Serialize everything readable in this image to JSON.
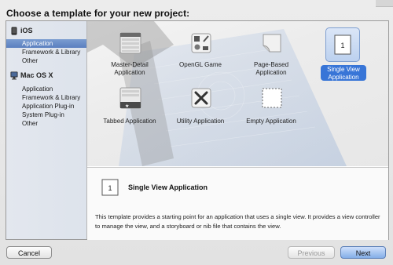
{
  "heading": "Choose a template for your new project:",
  "sidebar": {
    "sections": [
      {
        "title": "iOS",
        "items": [
          "Application",
          "Framework & Library",
          "Other"
        ]
      },
      {
        "title": "Mac OS X",
        "items": [
          "Application",
          "Application Plug-in",
          "Framework & Library",
          "System Plug-in",
          "Other"
        ]
      }
    ],
    "selected": "iOS / Application"
  },
  "templates": [
    {
      "label": "Master-Detail Application",
      "icon": "master-detail-icon"
    },
    {
      "label": "OpenGL Game",
      "icon": "opengl-game-icon"
    },
    {
      "label": "Page-Based Application",
      "icon": "page-based-icon"
    },
    {
      "label": "Single View Application",
      "icon": "single-view-icon",
      "selected": true
    },
    {
      "label": "Tabbed Application",
      "icon": "tabbed-icon"
    },
    {
      "label": "Utility Application",
      "icon": "utility-icon"
    },
    {
      "label": "Empty Application",
      "icon": "empty-app-icon"
    }
  ],
  "description": {
    "title": "Single View Application",
    "text": "This template provides a starting point for an application that uses a single view. It provides a view controller to manage the view, and a storyboard or nib file that contains the view."
  },
  "buttons": {
    "cancel": "Cancel",
    "previous": "Previous",
    "next": "Next"
  },
  "colors": {
    "selection": "#3875d7",
    "sidebar_selection": "#6a8fca"
  }
}
